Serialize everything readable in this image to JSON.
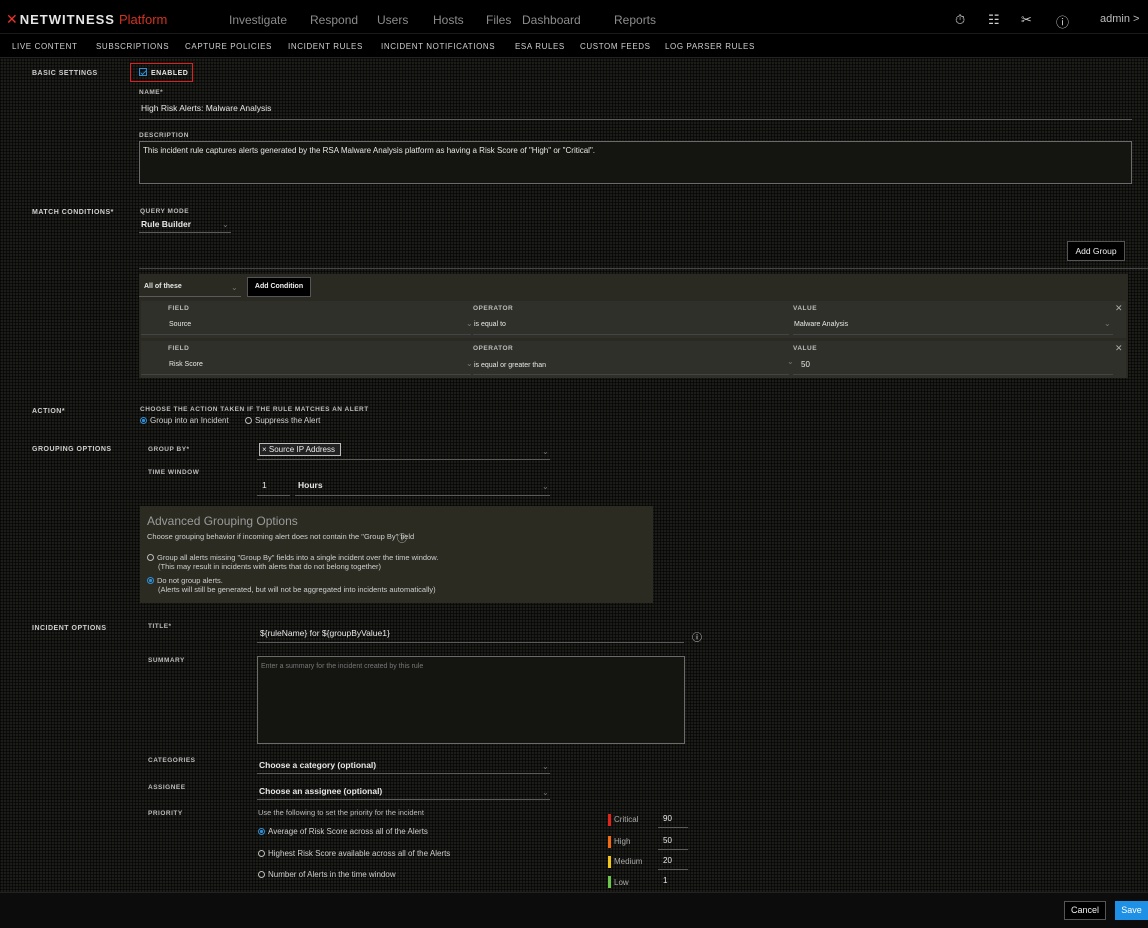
{
  "app": {
    "logo_text": "NETWITNESS",
    "logo_sub": "Platform",
    "nav": [
      "Investigate",
      "Respond",
      "Users",
      "Hosts",
      "Files",
      "Dashboard",
      "Reports"
    ],
    "user": "admin >",
    "icons": [
      "timer-icon",
      "list-icon",
      "tools-icon",
      "help-icon"
    ]
  },
  "subnav": [
    "LIVE CONTENT",
    "SUBSCRIPTIONS",
    "CAPTURE POLICIES",
    "INCIDENT RULES",
    "INCIDENT NOTIFICATIONS",
    "ESA RULES",
    "CUSTOM FEEDS",
    "LOG PARSER RULES"
  ],
  "basic": {
    "section": "BASIC SETTINGS",
    "enabled_label": "ENABLED",
    "name_label": "NAME*",
    "name_value": "High Risk Alerts: Malware Analysis",
    "description_label": "DESCRIPTION",
    "description_value": "This incident rule captures alerts generated by the RSA Malware Analysis platform as having a Risk Score of \"High\" or \"Critical\"."
  },
  "match": {
    "section": "MATCH CONDITIONS*",
    "query_mode_label": "QUERY MODE",
    "query_mode_value": "Rule Builder",
    "add_group": "Add Group",
    "logic": "All of these",
    "add_condition": "Add Condition",
    "headers": {
      "field": "FIELD",
      "operator": "OPERATOR",
      "value": "VALUE"
    },
    "conditions": [
      {
        "field": "Source",
        "operator": "is equal to",
        "value": "Malware Analysis"
      },
      {
        "field": "Risk Score",
        "operator": "is equal or greater than",
        "value": "50"
      }
    ]
  },
  "action": {
    "section": "ACTION*",
    "label": "CHOOSE THE ACTION TAKEN IF THE RULE MATCHES AN ALERT",
    "option1": "Group into an Incident",
    "option2": "Suppress the Alert"
  },
  "grouping": {
    "section": "GROUPING OPTIONS",
    "group_by_label": "GROUP BY*",
    "group_by_tag": "× Source IP Address",
    "time_window_label": "TIME WINDOW",
    "time_value": "1",
    "time_unit": "Hours",
    "adv_title": "Advanced Grouping Options",
    "adv_desc": "Choose grouping behavior if incoming alert does not contain the \"Group By\" field",
    "adv_opt1_l1": "Group all alerts missing \"Group By\" fields into a single incident over the time window.",
    "adv_opt1_l2": "(This may result in incidents with alerts that do not belong together)",
    "adv_opt2_l1": "Do not group alerts.",
    "adv_opt2_l2": "(Alerts will still be generated, but will not be aggregated into incidents automatically)"
  },
  "incident": {
    "section": "INCIDENT OPTIONS",
    "title_label": "TITLE*",
    "title_value": "${ruleName} for ${groupByValue1}",
    "summary_label": "SUMMARY",
    "summary_placeholder": "Enter a summary for the incident created by this rule",
    "categories_label": "CATEGORIES",
    "categories_value": "Choose a category (optional)",
    "assignee_label": "ASSIGNEE",
    "assignee_value": "Choose an assignee (optional)",
    "priority_label": "PRIORITY",
    "priority_desc": "Use the following to set the priority for the incident",
    "priority_opt1": "Average of Risk Score across all of the Alerts",
    "priority_opt2": "Highest Risk Score available across all of the Alerts",
    "priority_opt3": "Number of Alerts in the time window",
    "levels": [
      {
        "name": "Critical",
        "value": "90",
        "color": "#e0241b"
      },
      {
        "name": "High",
        "value": "50",
        "color": "#f26a12"
      },
      {
        "name": "Medium",
        "value": "20",
        "color": "#f2c51a"
      },
      {
        "name": "Low",
        "value": "1",
        "color": "#6cc64a"
      }
    ]
  },
  "footer": {
    "cancel": "Cancel",
    "save": "Save"
  }
}
